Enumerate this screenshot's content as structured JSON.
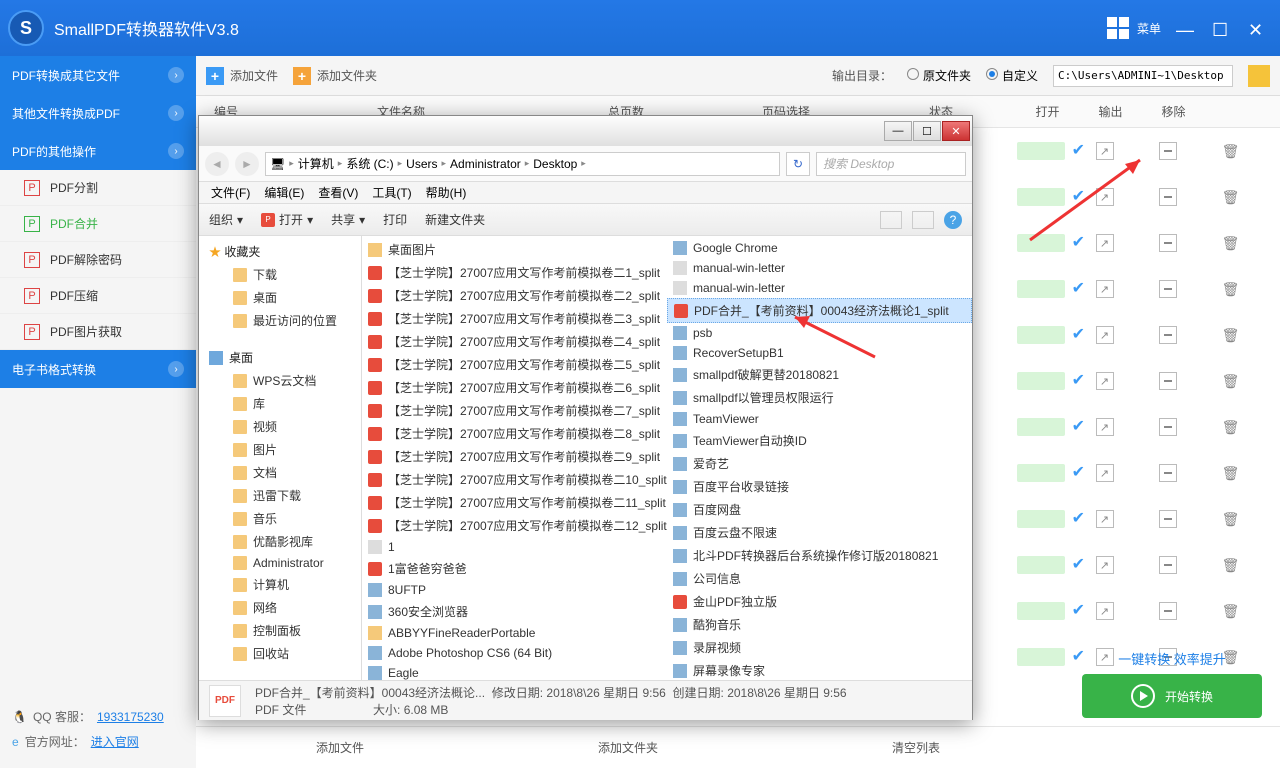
{
  "titlebar": {
    "title": "SmallPDF转换器软件V3.8",
    "menu": "菜单"
  },
  "sidebar": {
    "cats": [
      {
        "label": "PDF转换成其它文件"
      },
      {
        "label": "其他文件转换成PDF"
      },
      {
        "label": "PDF的其他操作"
      },
      {
        "label": "电子书格式转换"
      }
    ],
    "items": [
      {
        "label": "PDF分割"
      },
      {
        "label": "PDF合并"
      },
      {
        "label": "PDF解除密码"
      },
      {
        "label": "PDF压缩"
      },
      {
        "label": "PDF图片获取"
      }
    ],
    "footer": {
      "qq_label": "QQ 客服：",
      "qq": "1933175230",
      "site_label": "官方网址：",
      "site": "进入官网"
    }
  },
  "toolbar": {
    "add_file": "添加文件",
    "add_folder": "添加文件夹",
    "out_label": "输出目录：",
    "r1": "原文件夹",
    "r2": "自定义",
    "path": "C:\\Users\\ADMINI~1\\Desktop"
  },
  "thead": {
    "c1": "编号",
    "c2": "文件名称",
    "c3": "总页数",
    "c4": "页码选择",
    "c5": "状态",
    "c6": "打开",
    "c7": "输出",
    "c8": "移除"
  },
  "footbar": {
    "a": "添加文件",
    "b": "添加文件夹",
    "c": "清空列表"
  },
  "promo": {
    "text": "一键转换  效率提升",
    "btn": "开始转换"
  },
  "dialog": {
    "breadcrumb": [
      "计算机",
      "系统 (C:)",
      "Users",
      "Administrator",
      "Desktop"
    ],
    "search_ph": "搜索 Desktop",
    "menu": [
      "文件(F)",
      "编辑(E)",
      "查看(V)",
      "工具(T)",
      "帮助(H)"
    ],
    "tool": {
      "org": "组织",
      "open": "打开",
      "share": "共享",
      "print": "打印",
      "newf": "新建文件夹"
    },
    "tree": {
      "fav": "收藏夹",
      "fav_items": [
        "下载",
        "桌面",
        "最近访问的位置"
      ],
      "desk": "桌面",
      "desk_items": [
        "WPS云文档",
        "库",
        "视频",
        "图片",
        "文档",
        "迅雷下载",
        "音乐",
        "优酷影视库",
        "Administrator",
        "计算机",
        "网络",
        "控制面板",
        "回收站"
      ]
    },
    "filesL": [
      {
        "t": "fold",
        "n": "桌面图片"
      },
      {
        "t": "pdf",
        "n": "【芝士学院】27007应用文写作考前模拟卷二1_split"
      },
      {
        "t": "pdf",
        "n": "【芝士学院】27007应用文写作考前模拟卷二2_split"
      },
      {
        "t": "pdf",
        "n": "【芝士学院】27007应用文写作考前模拟卷二3_split"
      },
      {
        "t": "pdf",
        "n": "【芝士学院】27007应用文写作考前模拟卷二4_split"
      },
      {
        "t": "pdf",
        "n": "【芝士学院】27007应用文写作考前模拟卷二5_split"
      },
      {
        "t": "pdf",
        "n": "【芝士学院】27007应用文写作考前模拟卷二6_split"
      },
      {
        "t": "pdf",
        "n": "【芝士学院】27007应用文写作考前模拟卷二7_split"
      },
      {
        "t": "pdf",
        "n": "【芝士学院】27007应用文写作考前模拟卷二8_split"
      },
      {
        "t": "pdf",
        "n": "【芝士学院】27007应用文写作考前模拟卷二9_split"
      },
      {
        "t": "pdf",
        "n": "【芝士学院】27007应用文写作考前模拟卷二10_split"
      },
      {
        "t": "pdf",
        "n": "【芝士学院】27007应用文写作考前模拟卷二11_split"
      },
      {
        "t": "pdf",
        "n": "【芝士学院】27007应用文写作考前模拟卷二12_split"
      },
      {
        "t": "txt",
        "n": "1"
      },
      {
        "t": "pdf",
        "n": "1富爸爸穷爸爸"
      },
      {
        "t": "app",
        "n": "8UFTP"
      },
      {
        "t": "app",
        "n": "360安全浏览器"
      },
      {
        "t": "fold",
        "n": "ABBYYFineReaderPortable"
      },
      {
        "t": "app",
        "n": "Adobe Photoshop CS6 (64 Bit)"
      },
      {
        "t": "app",
        "n": "Eagle"
      }
    ],
    "filesR": [
      {
        "t": "app",
        "n": "Google Chrome"
      },
      {
        "t": "txt",
        "n": "manual-win-letter"
      },
      {
        "t": "txt",
        "n": "manual-win-letter"
      },
      {
        "t": "pdf",
        "n": "PDF合并_【考前资料】00043经济法概论1_split",
        "sel": true
      },
      {
        "t": "app",
        "n": "psb"
      },
      {
        "t": "app",
        "n": "RecoverSetupB1"
      },
      {
        "t": "app",
        "n": "smallpdf破解更替20180821"
      },
      {
        "t": "app",
        "n": "smallpdf以管理员权限运行"
      },
      {
        "t": "app",
        "n": "TeamViewer"
      },
      {
        "t": "app",
        "n": "TeamViewer自动换ID"
      },
      {
        "t": "app",
        "n": "爱奇艺"
      },
      {
        "t": "app",
        "n": "百度平台收录链接"
      },
      {
        "t": "app",
        "n": "百度网盘"
      },
      {
        "t": "app",
        "n": "百度云盘不限速"
      },
      {
        "t": "app",
        "n": "北斗PDF转换器后台系统操作修订版20180821"
      },
      {
        "t": "app",
        "n": "公司信息"
      },
      {
        "t": "pdf",
        "n": "金山PDF独立版"
      },
      {
        "t": "app",
        "n": "酷狗音乐"
      },
      {
        "t": "app",
        "n": "录屏视频"
      },
      {
        "t": "app",
        "n": "屏幕录像专家"
      }
    ],
    "foot": {
      "name": "PDF合并_【考前资料】00043经济法概论...",
      "type": "PDF 文件",
      "mod_l": "修改日期:",
      "mod": "2018\\8\\26 星期日 9:56",
      "size_l": "大小:",
      "size": "6.08 MB",
      "create_l": "创建日期:",
      "create": "2018\\8\\26 星期日 9:56"
    }
  }
}
